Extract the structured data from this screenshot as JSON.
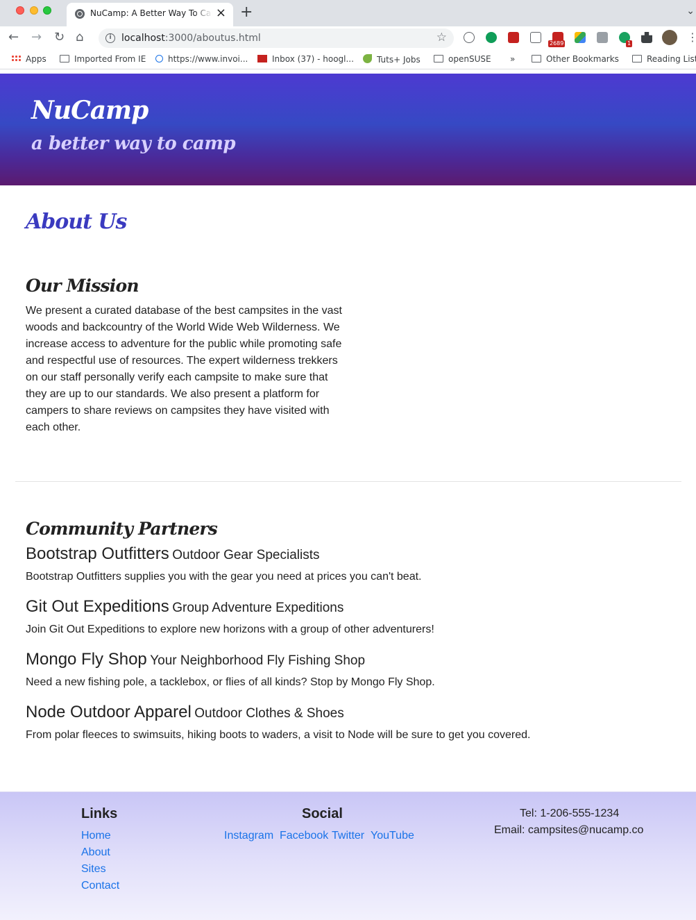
{
  "browser": {
    "tab_title": "NuCamp: A Better Way To Camp",
    "url_host": "localhost",
    "url_rest": ":3000/aboutus.html",
    "extension_badges": [
      "2689",
      "1"
    ],
    "bookmarks": [
      "Apps",
      "Imported From IE",
      "https://www.invoi...",
      "Inbox (37) - hoogl...",
      "Tuts+ Jobs",
      "openSUSE",
      "»",
      "Other Bookmarks",
      "Reading List"
    ]
  },
  "header": {
    "brand": "NuCamp",
    "tagline": "a better way to camp"
  },
  "about": {
    "title": "About Us",
    "mission_title": "Our Mission",
    "mission_text": "We present a curated database of the best campsites in the vast woods and backcountry of the World Wide Web Wilderness. We increase access to adventure for the public while promoting safe and respectful use of resources. The expert wilderness trekkers on our staff personally verify each campsite to make sure that they are up to our standards. We also present a platform for campers to share reviews on campsites they have visited with each other."
  },
  "partners": {
    "title": "Community Partners",
    "items": [
      {
        "name": "Bootstrap Outfitters",
        "subtitle": "Outdoor Gear Specialists",
        "description": "Bootstrap Outfitters supplies you with the gear you need at prices you can't beat."
      },
      {
        "name": "Git Out Expeditions",
        "subtitle": "Group Adventure Expeditions",
        "description": "Join Git Out Expeditions to explore new horizons with a group of other adventurers!"
      },
      {
        "name": "Mongo Fly Shop",
        "subtitle": "Your Neighborhood Fly Fishing Shop",
        "description": "Need a new fishing pole, a tacklebox, or flies of all kinds? Stop by Mongo Fly Shop."
      },
      {
        "name": "Node Outdoor Apparel",
        "subtitle": "Outdoor Clothes & Shoes",
        "description": "From polar fleeces to swimsuits, hiking boots to waders, a visit to Node will be sure to get you covered."
      }
    ]
  },
  "footer": {
    "links_title": "Links",
    "links": [
      "Home",
      "About",
      "Sites",
      "Contact"
    ],
    "social_title": "Social",
    "social": [
      "Instagram",
      "Facebook",
      "Twitter",
      "YouTube"
    ],
    "tel": "Tel: 1-206-555-1234",
    "email": "Email: campsites@nucamp.co"
  }
}
